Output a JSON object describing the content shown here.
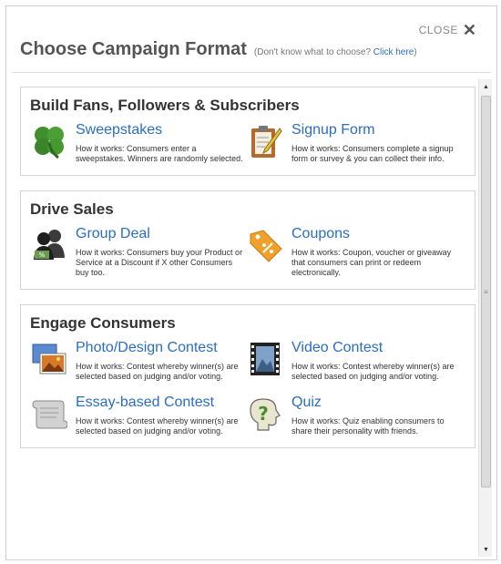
{
  "close": {
    "label": "CLOSE",
    "icon": "close-icon"
  },
  "header": {
    "title": "Choose Campaign Format",
    "hint_prefix": "(Don't know what to choose?",
    "hint_link": "Click here",
    "hint_suffix": ")"
  },
  "sections": [
    {
      "title": "Build Fans, Followers & Subscribers",
      "items": [
        {
          "name": "Sweepstakes",
          "desc": "How it works: Consumers enter a sweepstakes. Winners are randomly selected.",
          "icon": "clover-icon"
        },
        {
          "name": "Signup Form",
          "desc": "How it works: Consumers complete a signup form or survey & you can collect their info.",
          "icon": "clipboard-pencil-icon"
        }
      ]
    },
    {
      "title": "Drive Sales",
      "items": [
        {
          "name": "Group Deal",
          "desc": "How it works: Consumers buy your Product or Service at a Discount if X other Consumers buy too.",
          "icon": "group-discount-icon"
        },
        {
          "name": "Coupons",
          "desc": "How it works: Coupon, voucher or giveaway that consumers can print or redeem electronically.",
          "icon": "coupon-tag-icon"
        }
      ]
    },
    {
      "title": "Engage Consumers",
      "items": [
        {
          "name": "Photo/Design Contest",
          "desc": "How it works: Contest whereby winner(s) are selected based on judging and/or voting.",
          "icon": "photo-icon"
        },
        {
          "name": "Video Contest",
          "desc": "How it works: Contest whereby winner(s) are selected based on judging and/or voting.",
          "icon": "film-icon"
        },
        {
          "name": "Essay-based Contest",
          "desc": "How it works: Contest whereby winner(s) are selected based on judging and/or voting.",
          "icon": "scroll-icon"
        },
        {
          "name": "Quiz",
          "desc": "How it works: Quiz enabling consumers to share their personality with friends.",
          "icon": "quiz-head-icon"
        }
      ]
    }
  ],
  "colors": {
    "link": "#2a6ec2",
    "title": "#555555"
  }
}
